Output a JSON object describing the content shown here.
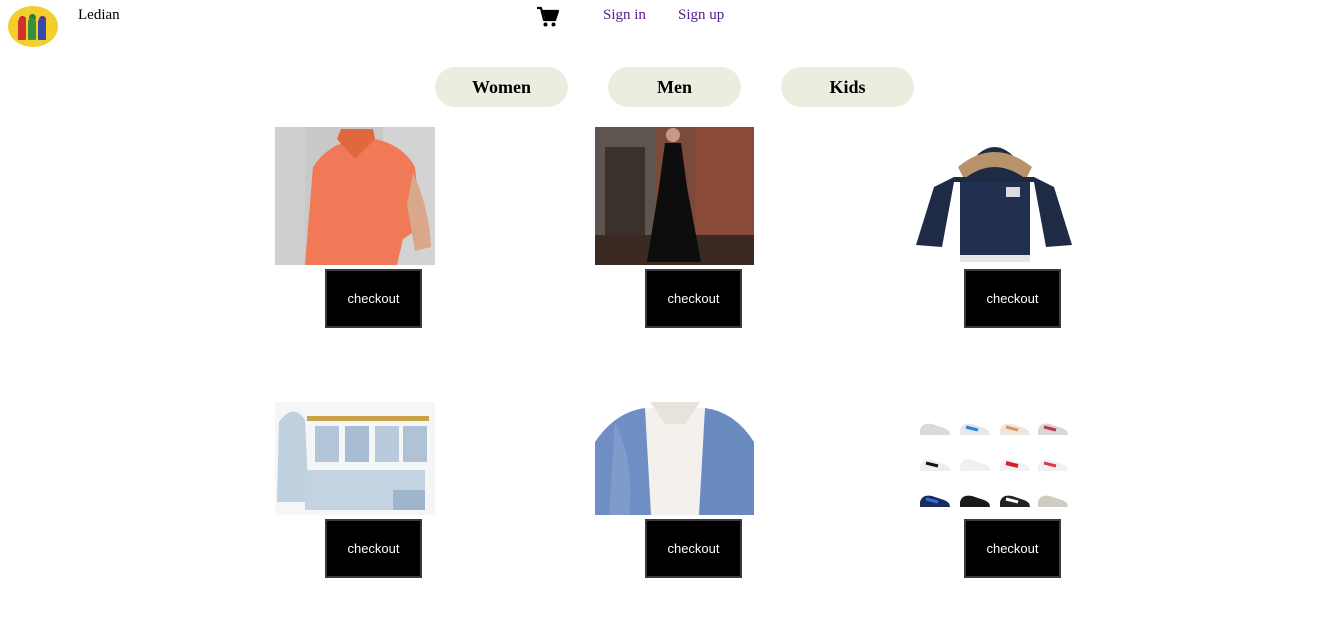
{
  "header": {
    "brand": "Ledian",
    "cart_icon": "shopping-cart-icon",
    "sign_in": "Sign in",
    "sign_up": "Sign up",
    "link_color": "#551a8b"
  },
  "categories": [
    "Women",
    "Men",
    "Kids"
  ],
  "category_color": "#e9eedf",
  "products": [
    {
      "image": "orange polo shirt",
      "button": "checkout"
    },
    {
      "image": "black long dress",
      "button": "checkout"
    },
    {
      "image": "navy hooded kids jacket",
      "button": "checkout"
    },
    {
      "image": "baby clothing set",
      "button": "checkout"
    },
    {
      "image": "blue fleece jacket",
      "button": "checkout"
    },
    {
      "image": "sneakers grid",
      "button": "checkout"
    }
  ]
}
